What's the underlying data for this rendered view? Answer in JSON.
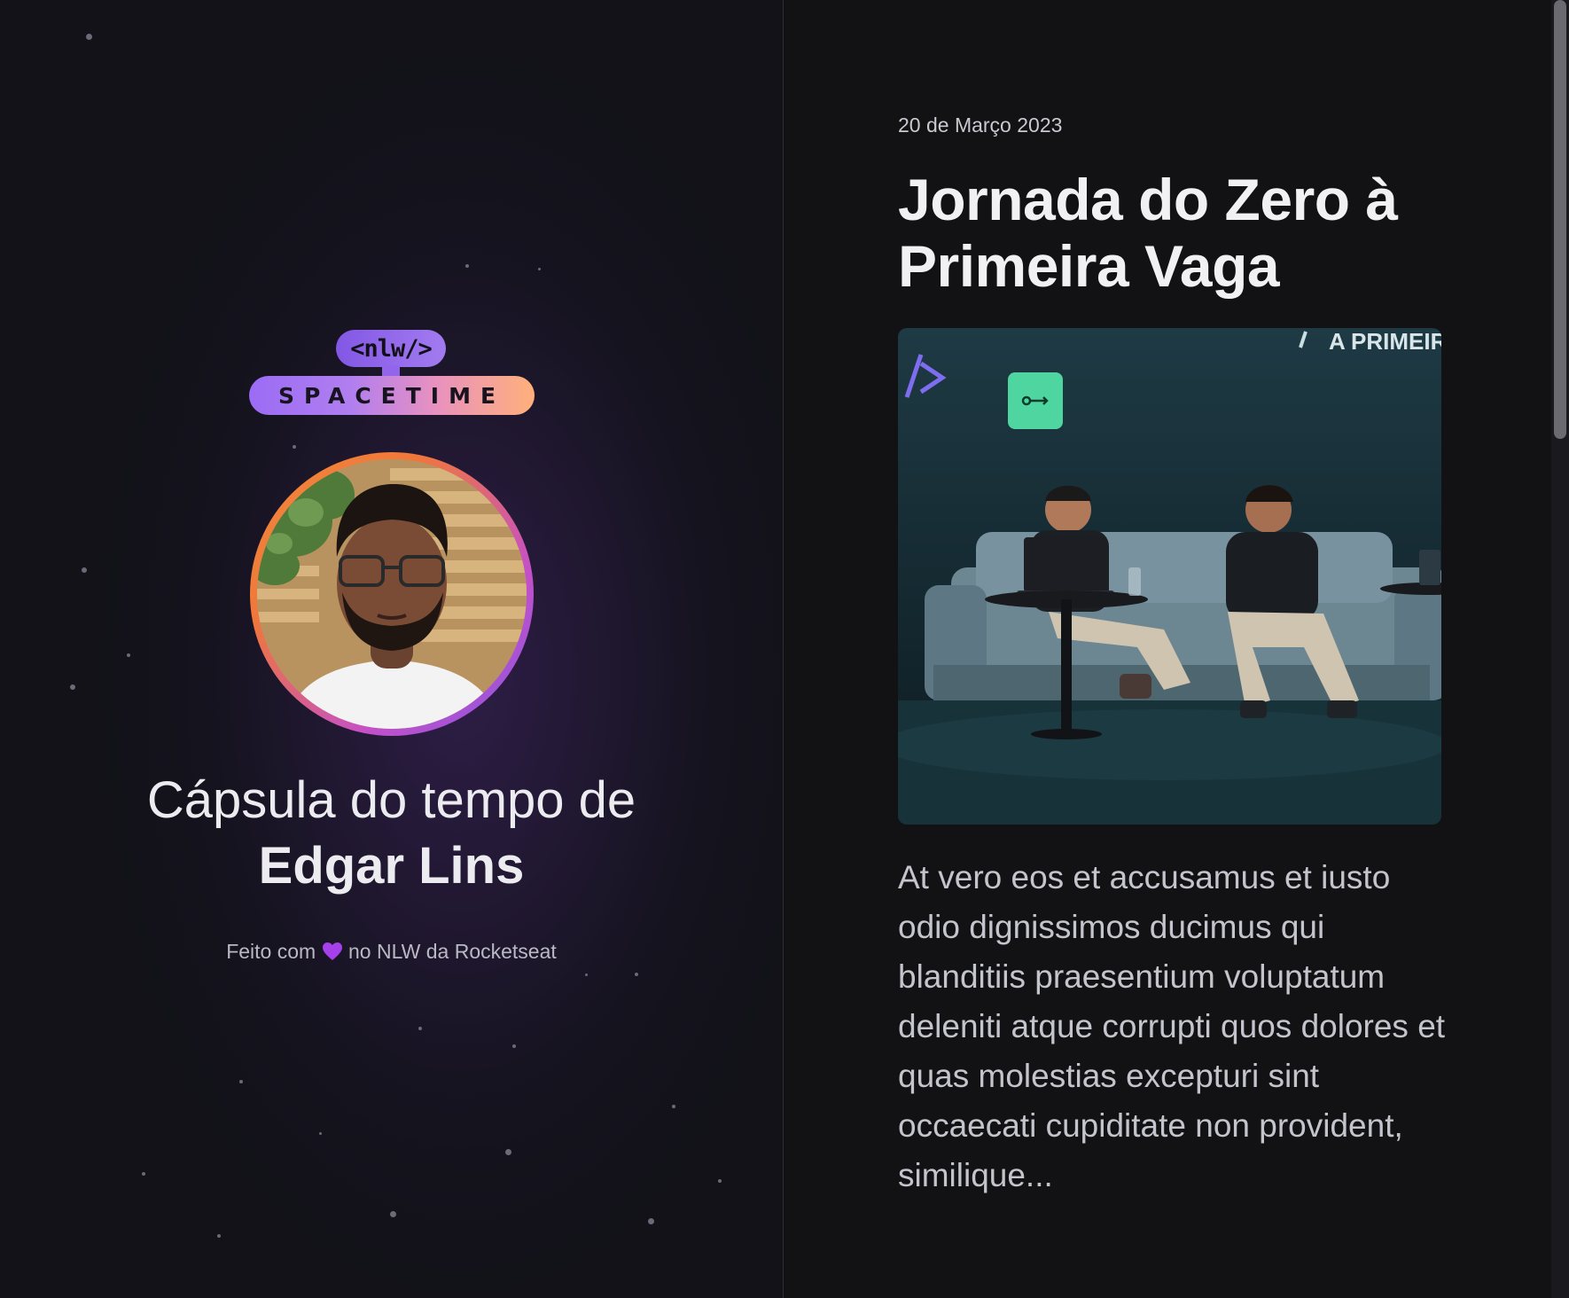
{
  "logo": {
    "badge_text": "<nlw/>",
    "bar_text": "SPACETIME"
  },
  "capsule": {
    "subtitle": "Cápsula do tempo de",
    "owner_name": "Edgar Lins",
    "credit_prefix": "Feito com",
    "credit_suffix": "no NLW da Rocketseat",
    "heart_icon": "purple-heart-icon"
  },
  "memory": {
    "date": "20 de Março 2023",
    "title": "Jornada do Zero à Primeira Vaga",
    "image_banner_text": "A PRIMEIR",
    "excerpt": "At vero eos et accusamus et iusto odio dignissimos ducimus qui blanditiis praesentium voluptatum deleniti atque corrupti quos dolores et quas molestias excepturi sint occaecati cupiditate non provident, similique..."
  },
  "colors": {
    "background": "#121215",
    "purple_accent": "#8257e5",
    "orange_accent": "#ffb07a",
    "text_primary": "#f1f1f4",
    "text_secondary": "#c4c4cc"
  }
}
